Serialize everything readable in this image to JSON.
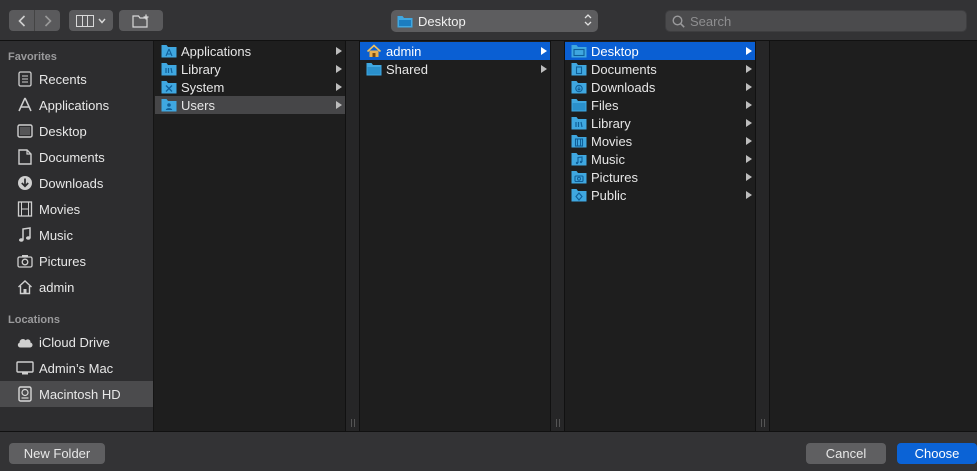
{
  "toolbar": {
    "path_label": "Desktop",
    "search_placeholder": "Search"
  },
  "sidebar": {
    "favorites_header": "Favorites",
    "locations_header": "Locations",
    "favorites": [
      {
        "label": "Recents",
        "icon": "clock-icon"
      },
      {
        "label": "Applications",
        "icon": "applications-icon"
      },
      {
        "label": "Desktop",
        "icon": "desktop-icon"
      },
      {
        "label": "Documents",
        "icon": "document-icon"
      },
      {
        "label": "Downloads",
        "icon": "downloads-icon"
      },
      {
        "label": "Movies",
        "icon": "film-icon"
      },
      {
        "label": "Music",
        "icon": "music-note-icon"
      },
      {
        "label": "Pictures",
        "icon": "camera-icon"
      },
      {
        "label": "admin",
        "icon": "home-icon"
      }
    ],
    "locations": [
      {
        "label": "iCloud Drive",
        "icon": "cloud-icon"
      },
      {
        "label": "Admin’s Mac",
        "icon": "monitor-icon"
      },
      {
        "label": "Macintosh HD",
        "icon": "hard-drive-icon",
        "selected": true
      }
    ]
  },
  "columns": [
    {
      "items": [
        {
          "label": "Applications",
          "selected": false
        },
        {
          "label": "Library",
          "selected": false
        },
        {
          "label": "System",
          "selected": false
        },
        {
          "label": "Users",
          "selected": true
        }
      ]
    },
    {
      "items": [
        {
          "label": "admin",
          "selected": true
        },
        {
          "label": "Shared",
          "selected": false
        }
      ]
    },
    {
      "items": [
        {
          "label": "Desktop",
          "selected": true
        },
        {
          "label": "Documents",
          "selected": false
        },
        {
          "label": "Downloads",
          "selected": false
        },
        {
          "label": "Files",
          "selected": false
        },
        {
          "label": "Library",
          "selected": false
        },
        {
          "label": "Movies",
          "selected": false
        },
        {
          "label": "Music",
          "selected": false
        },
        {
          "label": "Pictures",
          "selected": false
        },
        {
          "label": "Public",
          "selected": false
        }
      ]
    }
  ],
  "buttons": {
    "new_folder": "New Folder",
    "cancel": "Cancel",
    "choose": "Choose"
  },
  "colors": {
    "accent": "#0a5fd3",
    "folder": "#3fa7e0"
  }
}
